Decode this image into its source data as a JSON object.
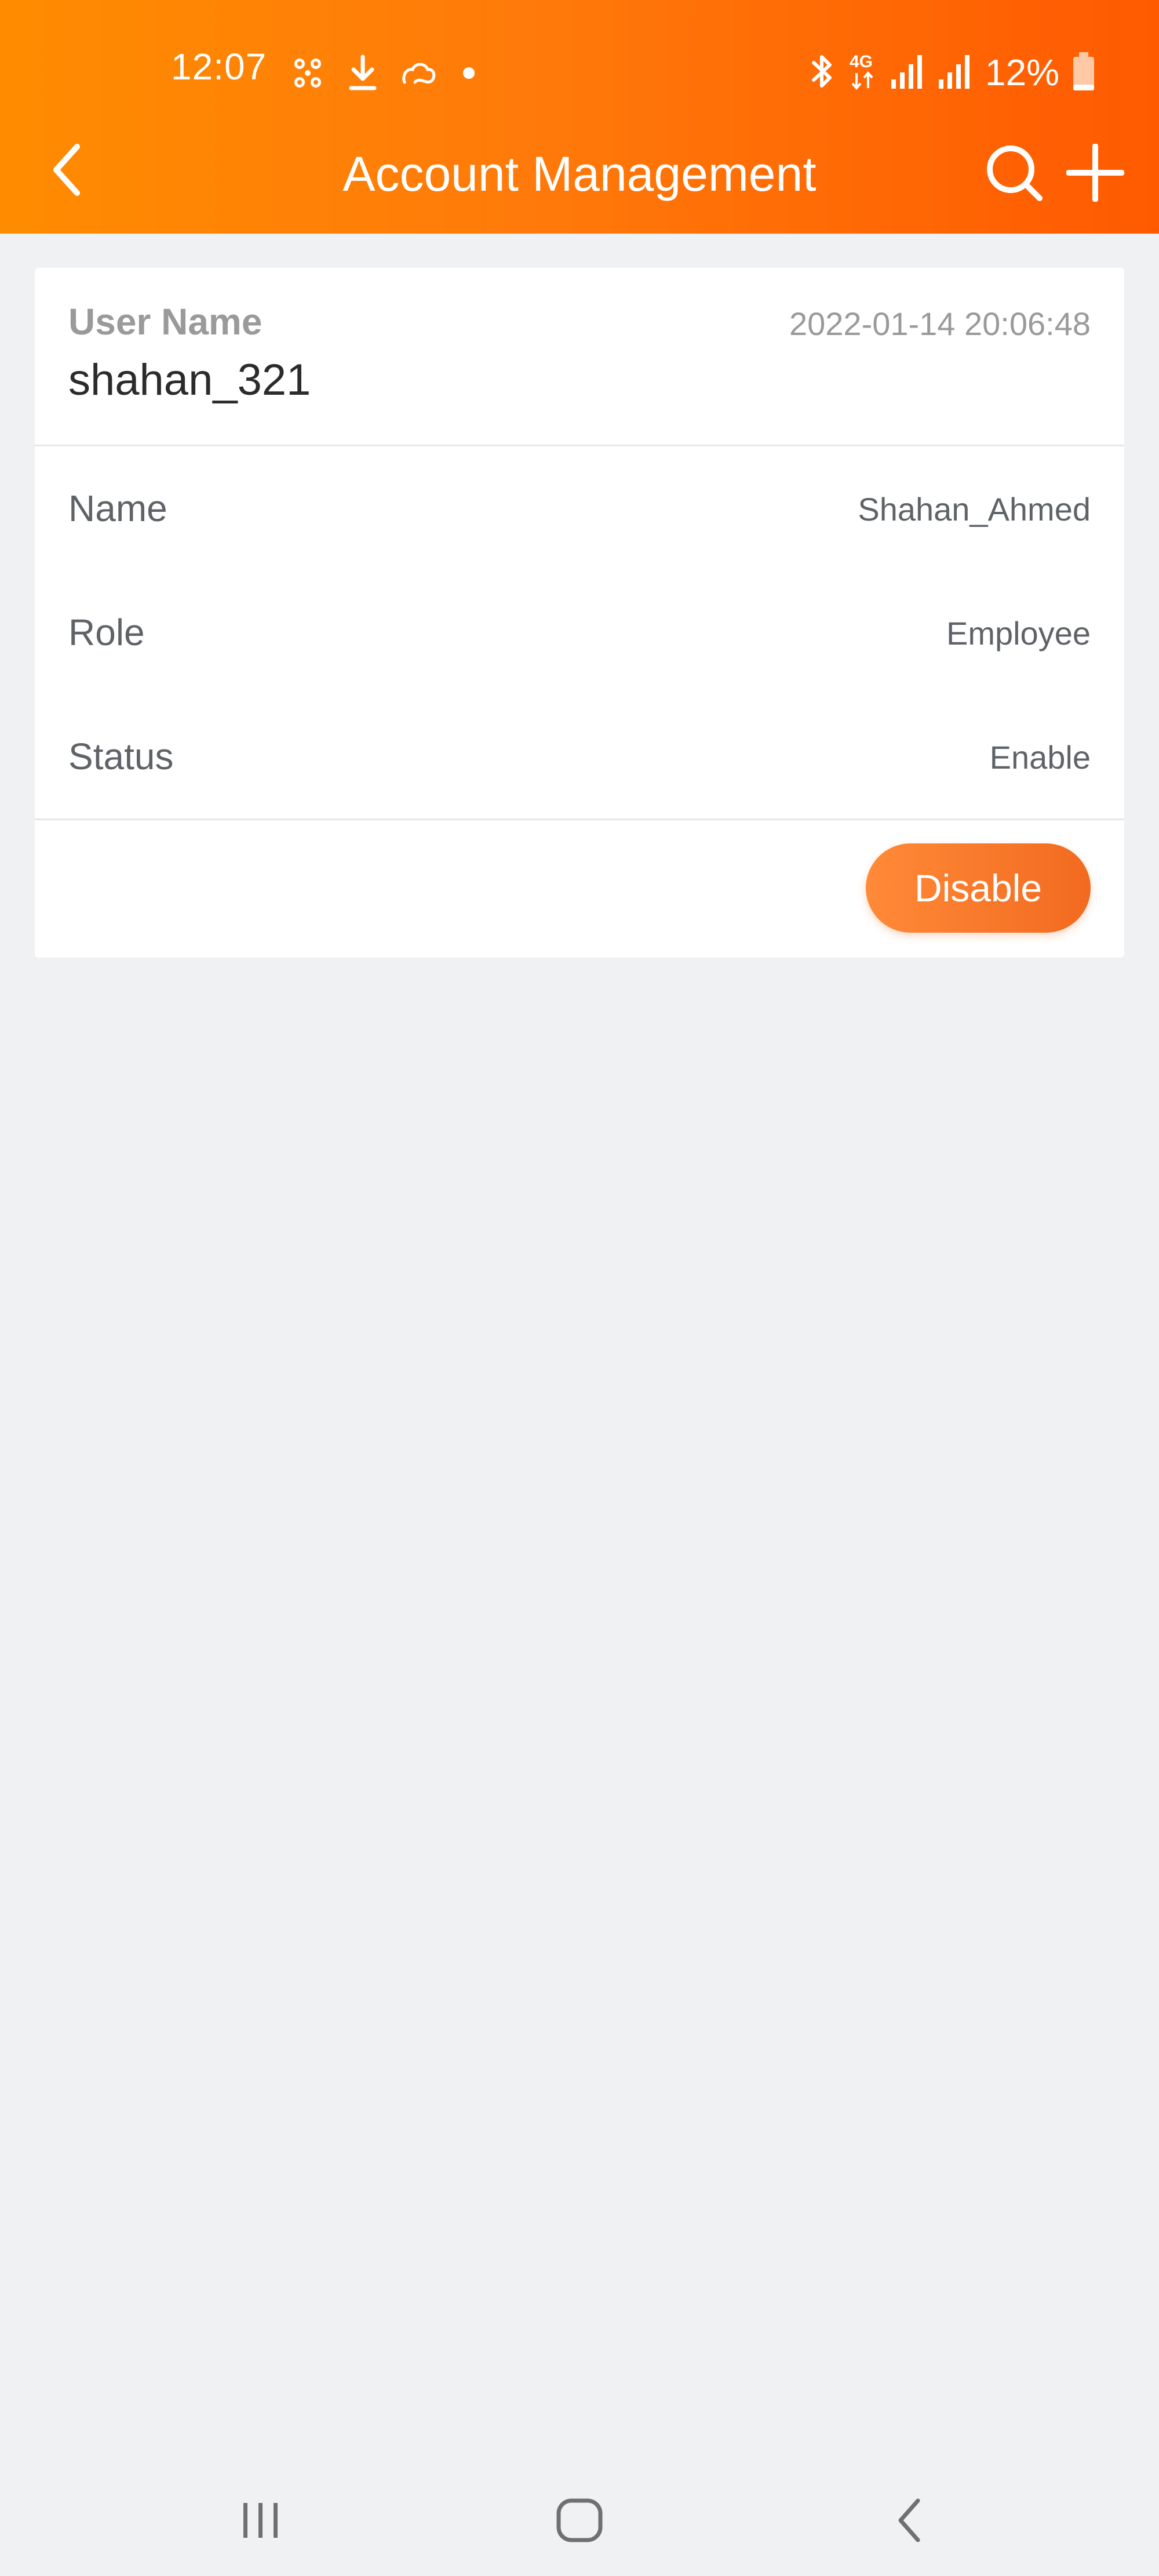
{
  "status_bar": {
    "time": "12:07",
    "battery": "12%",
    "network": "4G",
    "left_icons": [
      "fan-icon",
      "download-icon",
      "cloud-icon",
      "dot-icon"
    ],
    "right_icons": [
      "bluetooth-icon",
      "network-4g-icon",
      "signal-icon",
      "signal-icon",
      "battery-icon"
    ]
  },
  "app_bar": {
    "title": "Account Management",
    "back_icon": "chevron-left-icon",
    "actions": [
      "search-icon",
      "plus-icon"
    ]
  },
  "account": {
    "username_label": "User Name",
    "username": "shahan_321",
    "created_at": "2022-01-14 20:06:48",
    "fields": [
      {
        "label": "Name",
        "value": "Shahan_Ahmed"
      },
      {
        "label": "Role",
        "value": "Employee"
      },
      {
        "label": "Status",
        "value": "Enable"
      }
    ],
    "action_button": "Disable"
  },
  "nav_bar": {
    "buttons": [
      "recents-icon",
      "home-icon",
      "back-icon"
    ]
  },
  "colors": {
    "header_gradient_start": "#ff8c00",
    "header_gradient_end": "#ff5a00",
    "button_gradient_start": "#ff8a38",
    "button_gradient_end": "#f26a1f",
    "background": "#f0f1f2",
    "card": "#ffffff"
  }
}
